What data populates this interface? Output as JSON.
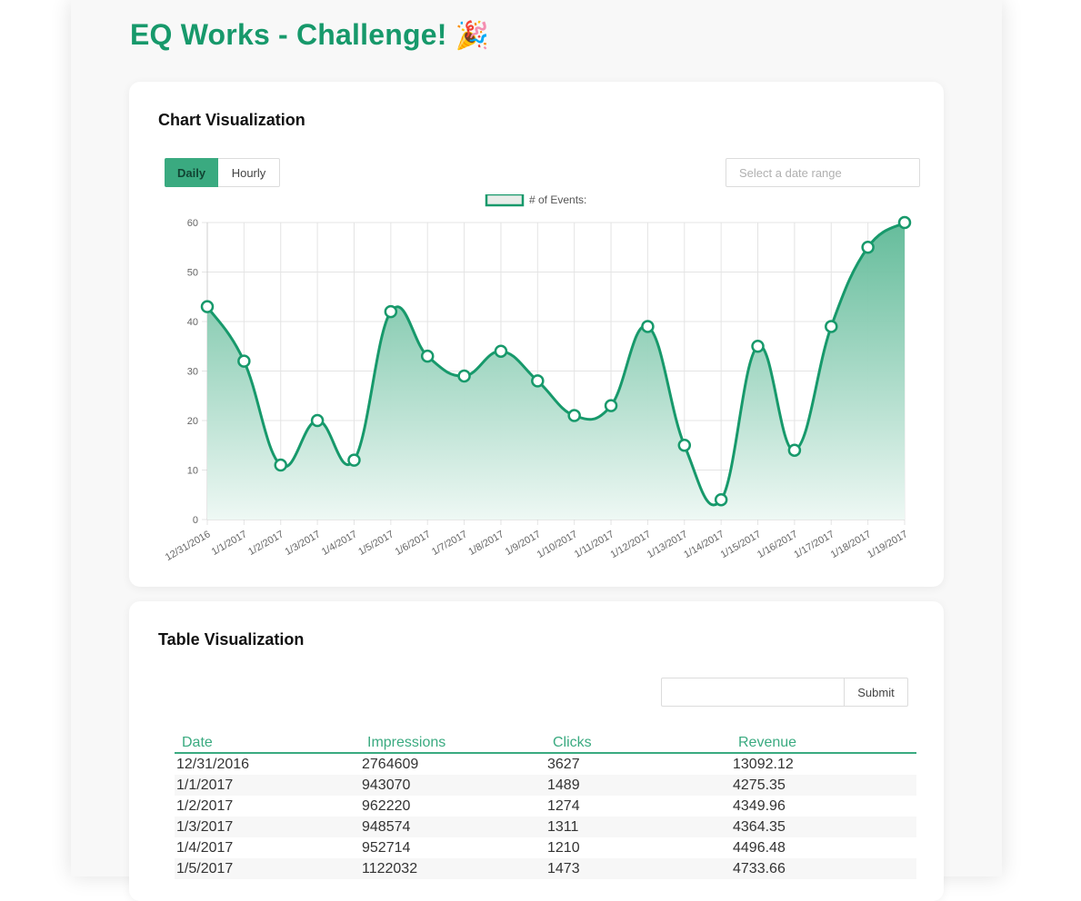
{
  "header": {
    "title": "EQ Works - Challenge!",
    "emoji": "🎉"
  },
  "chart_card": {
    "title": "Chart Visualization",
    "toggle": {
      "daily": "Daily",
      "hourly": "Hourly",
      "active": "Daily"
    },
    "date_range_placeholder": "Select a date range"
  },
  "chart_data": {
    "type": "area",
    "legend": "# of Events:",
    "legend_position": "top-center",
    "x": [
      "12/31/2016",
      "1/1/2017",
      "1/2/2017",
      "1/3/2017",
      "1/4/2017",
      "1/5/2017",
      "1/6/2017",
      "1/7/2017",
      "1/8/2017",
      "1/9/2017",
      "1/10/2017",
      "1/11/2017",
      "1/12/2017",
      "1/13/2017",
      "1/14/2017",
      "1/15/2017",
      "1/16/2017",
      "1/17/2017",
      "1/18/2017",
      "1/19/2017"
    ],
    "series": [
      {
        "name": "# of Events:",
        "values": [
          43,
          32,
          11,
          20,
          12,
          42,
          33,
          29,
          34,
          28,
          21,
          23,
          39,
          15,
          4,
          35,
          14,
          39,
          55,
          60
        ]
      }
    ],
    "ylim": [
      0,
      60
    ],
    "yticks": [
      0,
      10,
      20,
      30,
      40,
      50,
      60
    ],
    "grid": true,
    "colors": {
      "line": "#17996b",
      "fill_top": "#5db996",
      "fill_bottom": "#eef8f4",
      "grid": "#e4e4e4"
    }
  },
  "table_card": {
    "title": "Table Visualization",
    "search_placeholder": "",
    "submit_label": "Submit",
    "columns": [
      "Date",
      "Impressions",
      "Clicks",
      "Revenue"
    ],
    "rows": [
      [
        "12/31/2016",
        "2764609",
        "3627",
        "13092.12"
      ],
      [
        "1/1/2017",
        "943070",
        "1489",
        "4275.35"
      ],
      [
        "1/2/2017",
        "962220",
        "1274",
        "4349.96"
      ],
      [
        "1/3/2017",
        "948574",
        "1311",
        "4364.35"
      ],
      [
        "1/4/2017",
        "952714",
        "1210",
        "4496.48"
      ],
      [
        "1/5/2017",
        "1122032",
        "1473",
        "4733.66"
      ]
    ]
  }
}
